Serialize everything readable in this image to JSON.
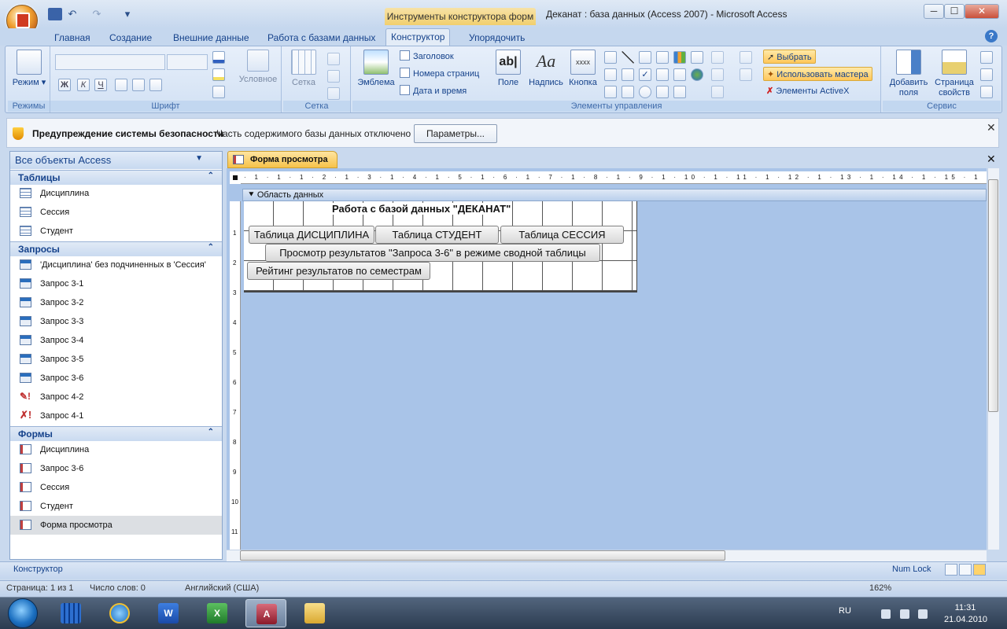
{
  "window": {
    "title": "Деканат : база данных (Access 2007) - Microsoft Access",
    "context_tab": "Инструменты конструктора форм",
    "controls": {
      "minimize": "─",
      "maximize": "☐",
      "close": "✕"
    }
  },
  "quick_access": {
    "undo": "↶",
    "redo": "↷",
    "dropdown": "▾"
  },
  "tabs": [
    "Главная",
    "Создание",
    "Внешние данные",
    "Работа с базами данных",
    "Конструктор",
    "Упорядочить"
  ],
  "active_tab": "Конструктор",
  "ribbon": {
    "groups": {
      "modes": "Режимы",
      "font": "Шрифт",
      "grid": "Сетка",
      "controls": "Элементы управления",
      "service": "Сервис"
    },
    "buttons": {
      "view": "Режим",
      "conditional": "Условное",
      "grid": "Сетка",
      "logo": "Эмблема",
      "title": "Заголовок",
      "page_numbers": "Номера страниц",
      "date_time": "Дата и время",
      "field": "Поле",
      "label": "Надпись",
      "button": "Кнопка",
      "select": "Выбрать",
      "use_wizards": "Использовать мастера",
      "activex": "Элементы ActiveX",
      "add_fields_1": "Добавить",
      "add_fields_2": "поля",
      "property_sheet_1": "Страница",
      "property_sheet_2": "свойств"
    },
    "font_format": {
      "bold": "Ж",
      "italic": "К",
      "underline": "Ч"
    }
  },
  "security_bar": {
    "title": "Предупреждение системы безопасности",
    "message": "Часть содержимого базы данных отключено",
    "button": "Параметры..."
  },
  "nav_pane": {
    "header": "Все объекты Access",
    "sections": {
      "tables": {
        "title": "Таблицы",
        "items": [
          "Дисциплина",
          "Сессия",
          "Студент"
        ]
      },
      "queries": {
        "title": "Запросы",
        "items": [
          "'Дисциплина' без подчиненных в 'Сессия'",
          "Запрос 3-1",
          "Запрос 3-2",
          "Запрос 3-3",
          "Запрос 3-4",
          "Запрос 3-5",
          "Запрос 3-6",
          "Запрос 4-2",
          "Запрос 4-1"
        ]
      },
      "forms": {
        "title": "Формы",
        "items": [
          "Дисциплина",
          "Запрос 3-6",
          "Сессия",
          "Студент",
          "Форма просмотра"
        ]
      }
    },
    "selected": "Форма просмотра"
  },
  "document": {
    "tab_title": "Форма просмотра",
    "section": "Область данных",
    "ruler_h": "· 1 · 1 · 1 · 2 · 1 · 3 · 1 · 4 · 1 · 5 · 1 · 6 · 1 · 7 · 1 · 8 · 1 · 9 · 1 · 10 · 1 · 11 · 1 · 12 · 1 · 13 · 1 · 14 · 1 · 15 · 1 · 16 · 1 · 17 · 1 · 18 · 1 · 19 · 1 · 20 · 1 · 21 · 1 · 22 · 1 · 23 · 1 · 24 · 1 · 2",
    "ruler_v": [
      "1",
      "2",
      "3",
      "4",
      "5",
      "6",
      "7",
      "8",
      "9",
      "10",
      "11"
    ],
    "form_title": "Работа с базой данных \"ДЕКАНАТ\"",
    "buttons": {
      "table_discipline": "Таблица ДИСЦИПЛИНА",
      "table_student": "Таблица СТУДЕНТ",
      "table_session": "Таблица СЕССИЯ",
      "pivot_view": "Просмотр результатов \"Запроса  3-6\" в режиме сводной таблицы",
      "rating": "Рейтинг результатов по семестрам"
    }
  },
  "status_bar": {
    "mode": "Конструктор",
    "numlock": "Num Lock"
  },
  "word_status": {
    "page": "Страница: 1 из 1",
    "words": "Число слов: 0",
    "language": "Английский (США)",
    "zoom": "162%"
  },
  "taskbar": {
    "language": "RU",
    "time": "11:31",
    "date": "21.04.2010"
  },
  "colors": {
    "accent": "#15428b",
    "ribbon": "#dbe6f5",
    "active_tab": "#f6c24a",
    "canvas": "#a9c4e8"
  }
}
